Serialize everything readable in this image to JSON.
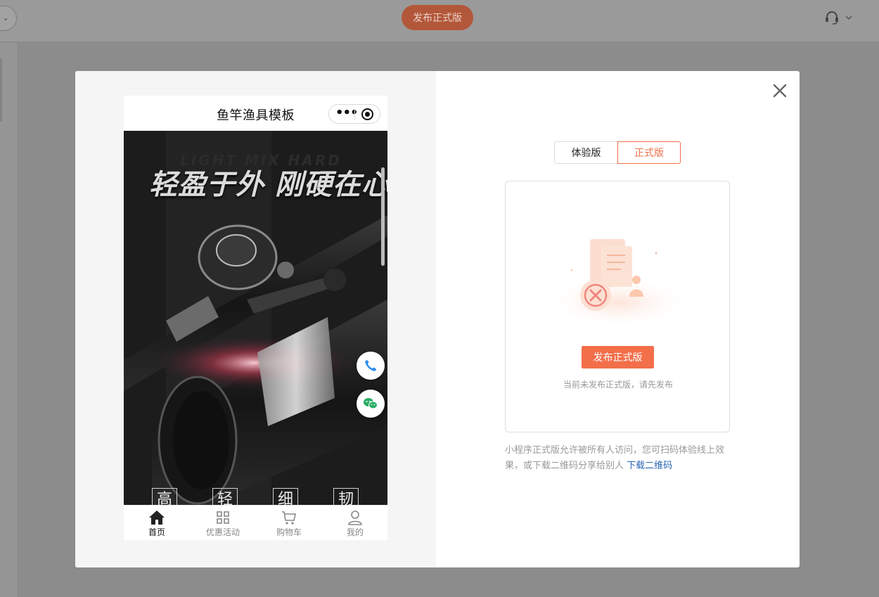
{
  "topbar": {
    "publish_label": "发布正式版",
    "support_icon": "headset-icon",
    "chevron": "⌄"
  },
  "modal": {
    "close_icon": "close-icon",
    "phone": {
      "title": "鱼竿渔具模板",
      "menu_dots": "•••",
      "banner": {
        "headline": "轻盈于外 刚硬在心",
        "bg_text": "LIGHT MIX HARD",
        "feature_chars": [
          "高",
          "轻",
          "细",
          "韧"
        ]
      },
      "float_buttons": [
        "phone-icon",
        "wechat-icon"
      ],
      "tabs": [
        {
          "label": "首页",
          "icon": "home-icon",
          "active": true
        },
        {
          "label": "优惠活动",
          "icon": "grid-icon",
          "active": false
        },
        {
          "label": "购物车",
          "icon": "cart-icon",
          "active": false
        },
        {
          "label": "我的",
          "icon": "user-icon",
          "active": false
        }
      ]
    },
    "version_tabs": [
      {
        "label": "体验版",
        "active": false
      },
      {
        "label": "正式版",
        "active": true
      }
    ],
    "publish_button": "发布正式版",
    "hint": "当前未发布正式版，请先发布",
    "description": "小程序正式版允许被所有人访问，您可扫码体验线上效果，或下载二维码分享给别人",
    "download_link": "下载二维码",
    "colors": {
      "accent": "#f26f4a",
      "link": "#2a64b3",
      "overlay": "#8c8c8c"
    }
  }
}
